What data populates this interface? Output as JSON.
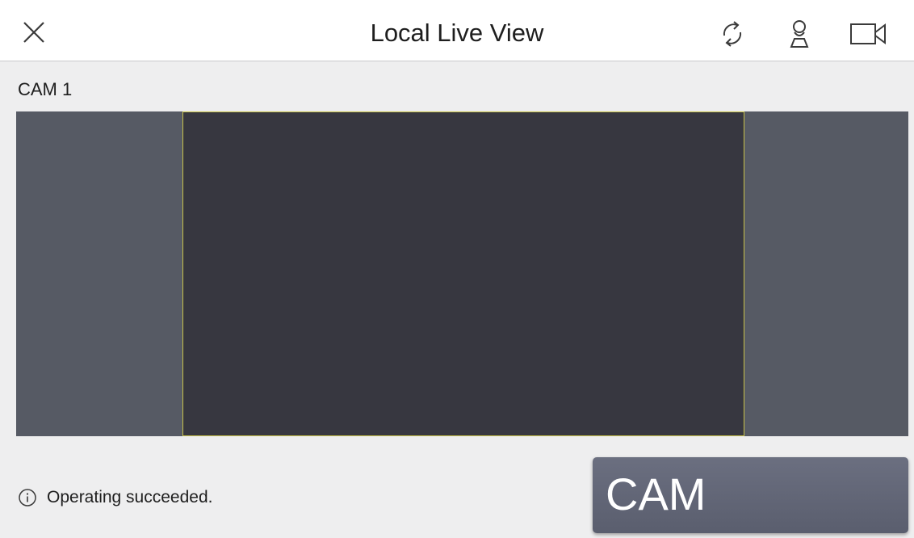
{
  "header": {
    "title": "Local Live View",
    "icons": [
      "close-icon",
      "refresh-icon",
      "person-location-icon",
      "video-camera-icon"
    ]
  },
  "camera": {
    "label": "CAM 1"
  },
  "status": {
    "icon": "info-icon",
    "text": "Operating succeeded."
  },
  "cam_button": {
    "label": "CAM"
  },
  "colors": {
    "background": "#eeeeef",
    "header_bg": "#ffffff",
    "video_bg": "#565a64",
    "video_frame_bg": "#373740",
    "selection_border": "#c8c24a",
    "button_bg": "#62667a"
  }
}
